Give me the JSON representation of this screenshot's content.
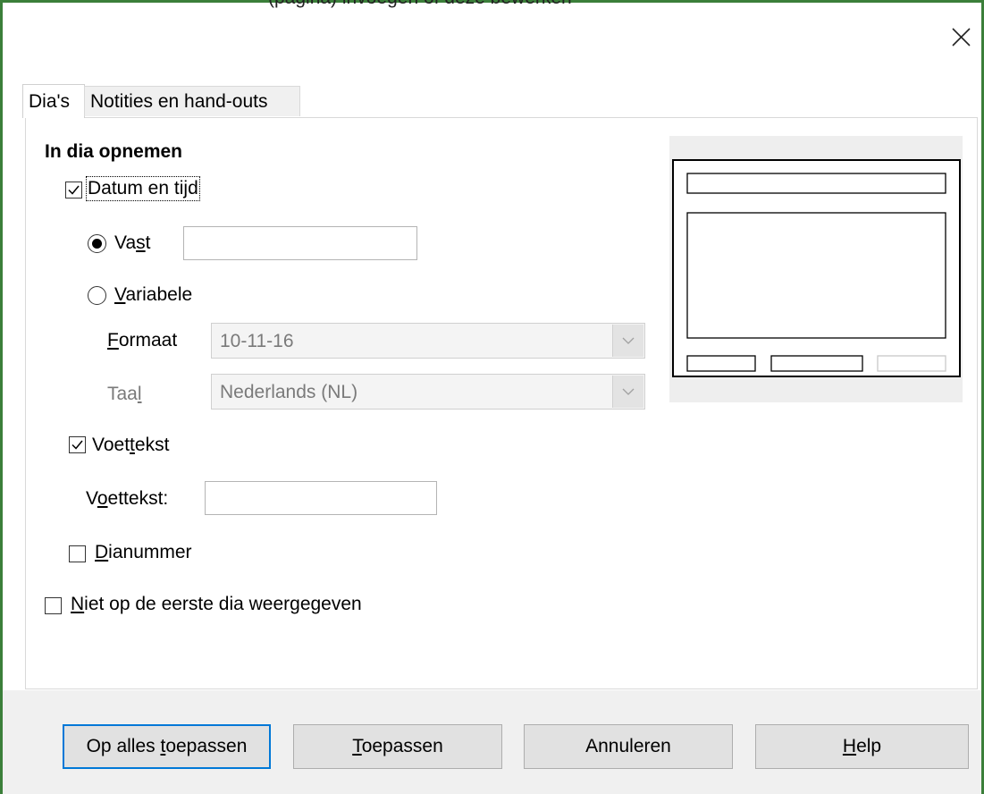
{
  "window": {
    "title_fragment": "(pagina) invoegen of deze bewerken"
  },
  "tabs": [
    {
      "label": "Dia's",
      "active": true
    },
    {
      "label": "Notities en hand-outs",
      "active": false
    }
  ],
  "section": {
    "heading": "In dia opnemen"
  },
  "date_time": {
    "checkbox_label_before": "Datum en ti",
    "checkbox_label_accel": "j",
    "checkbox_label_after": "d",
    "checked": true,
    "fixed": {
      "label_before": "Va",
      "label_accel": "s",
      "label_after": "t",
      "selected": true,
      "value": ""
    },
    "variable": {
      "label_accel": "V",
      "label_after": "ariabele",
      "selected": false
    },
    "format": {
      "label_accel": "F",
      "label_after": "ormaat",
      "value": "10-11-16"
    },
    "language": {
      "label_before": "Taa",
      "label_accel": "l",
      "value": "Nederlands (NL)"
    }
  },
  "footer": {
    "checkbox_label_before": "Voet",
    "checkbox_label_accel": "t",
    "checkbox_label_after": "ekst",
    "checked": true,
    "field_label_before": "V",
    "field_label_accel": "o",
    "field_label_after": "ettekst:",
    "value": ""
  },
  "slide_number": {
    "label_accel": "D",
    "label_after": "ianummer",
    "checked": false
  },
  "not_first": {
    "label_accel": "N",
    "label_after": "iet op de eerste dia weergegeven",
    "checked": false
  },
  "buttons": {
    "apply_all_before": "Op alles ",
    "apply_all_accel": "t",
    "apply_all_after": "oepassen",
    "apply_accel": "T",
    "apply_after": "oepassen",
    "cancel": "Annuleren",
    "help_accel": "H",
    "help_after": "elp"
  },
  "colors": {
    "frame": "#3b7f3a",
    "focus_border": "#0078d7",
    "disabled_text": "#7a7a7a"
  },
  "icons": {
    "close": "close-icon",
    "check": "checkmark-icon",
    "dropdown": "chevron-down-icon"
  }
}
